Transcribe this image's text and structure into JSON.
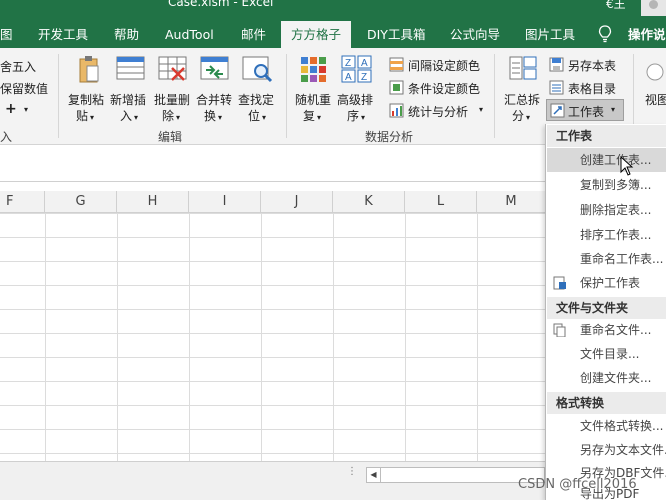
{
  "window": {
    "title": "Case.xlsm  -  Excel",
    "user_glyph": "€王"
  },
  "tabs": [
    {
      "label": "图",
      "active": false
    },
    {
      "label": "开发工具",
      "active": false
    },
    {
      "label": "帮助",
      "active": false
    },
    {
      "label": "AudTool",
      "active": false
    },
    {
      "label": "邮件",
      "active": false
    },
    {
      "label": "方方格子",
      "active": true
    },
    {
      "label": "DIY工具箱",
      "active": false
    },
    {
      "label": "公式向导",
      "active": false
    },
    {
      "label": "图片工具",
      "active": false
    }
  ],
  "help_search": "操作说明",
  "ribbon": {
    "left_partial": {
      "round": "舍五入",
      "keep": "保留数值",
      "plus": "+",
      "group": "入"
    },
    "buttons": {
      "copy_paste": [
        "复制粘",
        "贴"
      ],
      "insert": [
        "新增插",
        "入"
      ],
      "batch_delete": [
        "批量删",
        "除"
      ],
      "merge_convert": [
        "合并转",
        "换"
      ],
      "find_locate": [
        "查找定",
        "位"
      ],
      "random_repeat": [
        "随机重",
        "复"
      ],
      "advanced_sort": [
        "高级排",
        "序"
      ],
      "summary_split": [
        "汇总拆",
        "分"
      ],
      "view": "视图"
    },
    "small": {
      "interval_color": "间隔设定颜色",
      "conditional_color": "条件设定颜色",
      "stats_analysis": "统计与分析",
      "save_as_sheet": "另存本表",
      "table_directory": "表格目录",
      "worksheet": "工作表"
    },
    "groups": {
      "edit": "编辑",
      "data_analysis": "数据分析"
    }
  },
  "sheet": {
    "columns": [
      "F",
      "G",
      "H",
      "I",
      "J",
      "K",
      "L",
      "M"
    ]
  },
  "dropdown": {
    "section_worksheet": "工作表",
    "create_sheet": "创建工作表...",
    "copy_to_multiple": "复制到多簿...",
    "delete_specified": "删除指定表...",
    "sort_sheets": "排序工作表...",
    "rename_sheets": "重命名工作表...",
    "protect_sheets": "保护工作表",
    "section_files": "文件与文件夹",
    "rename_files": "重命名文件...",
    "file_directory": "文件目录...",
    "create_folder": "创建文件夹...",
    "section_format": "格式转换",
    "file_format_convert": "文件格式转换...",
    "save_as_text": "另存为文本文件...",
    "save_as_dbf": "另存为DBF文件...",
    "export_pdf": "导出为PDF"
  },
  "watermark": "CSDN @ffcell2016"
}
